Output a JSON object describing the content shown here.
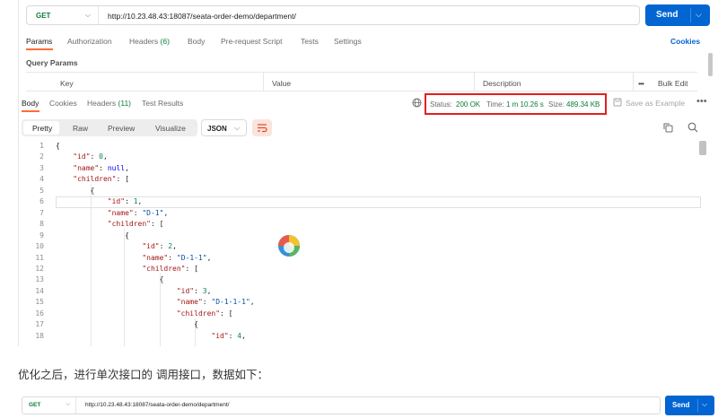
{
  "request": {
    "method": "GET",
    "url": "http://10.23.48.43:18087/seata-order-demo/department/",
    "send_label": "Send"
  },
  "request_tabs": {
    "params": "Params",
    "authorization": "Authorization",
    "headers": "Headers",
    "headers_count": "(6)",
    "body": "Body",
    "prerequest": "Pre-request Script",
    "tests": "Tests",
    "settings": "Settings",
    "cookies": "Cookies"
  },
  "query_params": {
    "title": "Query Params",
    "col_key": "Key",
    "col_value": "Value",
    "col_description": "Description",
    "bulk_edit": "Bulk Edit",
    "more": "•••"
  },
  "response_tabs": {
    "body": "Body",
    "cookies": "Cookies",
    "headers": "Headers",
    "headers_count": "(11)",
    "test_results": "Test Results"
  },
  "response_status": {
    "status_label": "Status:",
    "status_value": "200 OK",
    "time_label": "Time:",
    "time_value": "1 m 10.26 s",
    "size_label": "Size:",
    "size_value": "489.34 KB",
    "save_example": "Save as Example",
    "more": "•••"
  },
  "view_modes": {
    "pretty": "Pretty",
    "raw": "Raw",
    "preview": "Preview",
    "visualize": "Visualize",
    "format": "JSON"
  },
  "code_lines": [
    {
      "n": "1",
      "text": "{"
    },
    {
      "n": "2",
      "text": "    \"id\": 0,"
    },
    {
      "n": "3",
      "text": "    \"name\": null,"
    },
    {
      "n": "4",
      "text": "    \"children\": ["
    },
    {
      "n": "5",
      "text": "        {"
    },
    {
      "n": "6",
      "text": "            \"id\": 1,"
    },
    {
      "n": "7",
      "text": "            \"name\": \"D-1\","
    },
    {
      "n": "8",
      "text": "            \"children\": ["
    },
    {
      "n": "9",
      "text": "                {"
    },
    {
      "n": "10",
      "text": "                    \"id\": 2,"
    },
    {
      "n": "11",
      "text": "                    \"name\": \"D-1-1\","
    },
    {
      "n": "12",
      "text": "                    \"children\": ["
    },
    {
      "n": "13",
      "text": "                        {"
    },
    {
      "n": "14",
      "text": "                            \"id\": 3,"
    },
    {
      "n": "15",
      "text": "                            \"name\": \"D-1-1-1\","
    },
    {
      "n": "16",
      "text": "                            \"children\": ["
    },
    {
      "n": "17",
      "text": "                                {"
    },
    {
      "n": "18",
      "text": "                                    \"id\": 4,"
    }
  ],
  "caption": "优化之后，进行单次接口的 调用接口，数据如下：",
  "request2": {
    "method": "GET",
    "url": "http://10.23.48.43:18087/seata-order-demo/department/",
    "send_label": "Send"
  },
  "colors": {
    "send_blue": "#0265d2",
    "accent_orange": "#ff6c37",
    "status_green": "#0a7d3b",
    "highlight_red": "#e02020"
  }
}
